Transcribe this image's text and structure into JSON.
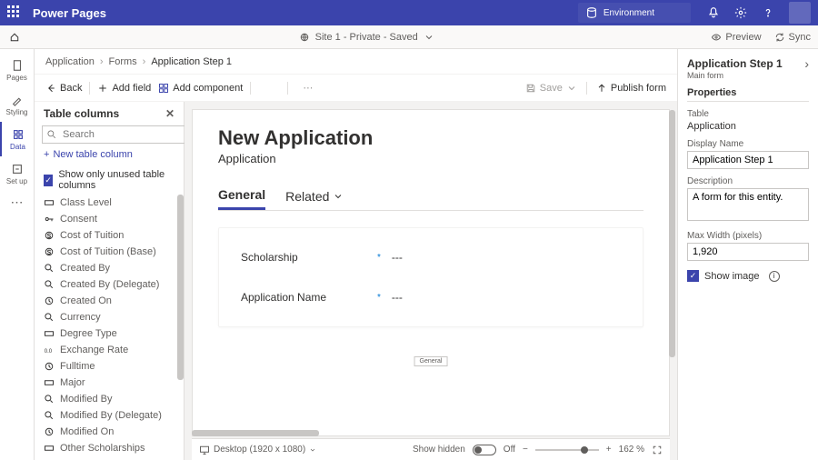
{
  "app": {
    "name": "Power Pages",
    "env_label": "Environment"
  },
  "sitebar": {
    "site": "Site 1 - Private - Saved",
    "preview": "Preview",
    "sync": "Sync"
  },
  "rail": [
    {
      "id": "pages",
      "label": "Pages"
    },
    {
      "id": "styling",
      "label": "Styling"
    },
    {
      "id": "data",
      "label": "Data"
    },
    {
      "id": "setup",
      "label": "Set up"
    }
  ],
  "crumbs": [
    "Application",
    "Forms",
    "Application Step 1"
  ],
  "toolbar": {
    "back": "Back",
    "add_field": "Add field",
    "add_component": "Add component",
    "save": "Save",
    "publish": "Publish form"
  },
  "columns_panel": {
    "title": "Table columns",
    "search_placeholder": "Search",
    "new": "New table column",
    "show_unused": "Show only unused table columns",
    "items": [
      "Class Level",
      "Consent",
      "Cost of Tuition",
      "Cost of Tuition (Base)",
      "Created By",
      "Created By (Delegate)",
      "Created On",
      "Currency",
      "Degree Type",
      "Exchange Rate",
      "Fulltime",
      "Major",
      "Modified By",
      "Modified By (Delegate)",
      "Modified On",
      "Other Scholarships"
    ],
    "item_icons": [
      "rect",
      "key",
      "money",
      "money",
      "search",
      "search",
      "clock",
      "search",
      "rect",
      "num",
      "clock",
      "rect",
      "search",
      "search",
      "clock",
      "rect"
    ]
  },
  "form": {
    "title": "New Application",
    "entity": "Application",
    "tabs": [
      "General",
      "Related"
    ],
    "fields": [
      {
        "label": "Scholarship",
        "value": "---"
      },
      {
        "label": "Application Name",
        "value": "---"
      }
    ],
    "section_tag": "General"
  },
  "bottom": {
    "viewport": "Desktop (1920 x 1080)",
    "show_hidden": "Show hidden",
    "off": "Off",
    "zoom": "162 %"
  },
  "props": {
    "name": "Application Step 1",
    "subform": "Main form",
    "section": "Properties",
    "table_lbl": "Table",
    "table_val": "Application",
    "display_lbl": "Display Name",
    "display_val": "Application Step 1",
    "desc_lbl": "Description",
    "desc_val": "A form for this entity.",
    "width_lbl": "Max Width (pixels)",
    "width_val": "1,920",
    "show_image": "Show image"
  }
}
